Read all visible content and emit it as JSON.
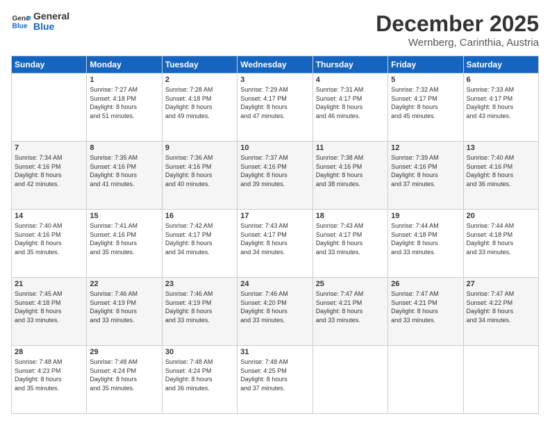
{
  "logo": {
    "line1": "General",
    "line2": "Blue"
  },
  "title": "December 2025",
  "subtitle": "Wernberg, Carinthia, Austria",
  "days_header": [
    "Sunday",
    "Monday",
    "Tuesday",
    "Wednesday",
    "Thursday",
    "Friday",
    "Saturday"
  ],
  "weeks": [
    [
      {
        "day": "",
        "text": ""
      },
      {
        "day": "1",
        "text": "Sunrise: 7:27 AM\nSunset: 4:18 PM\nDaylight: 8 hours\nand 51 minutes."
      },
      {
        "day": "2",
        "text": "Sunrise: 7:28 AM\nSunset: 4:18 PM\nDaylight: 8 hours\nand 49 minutes."
      },
      {
        "day": "3",
        "text": "Sunrise: 7:29 AM\nSunset: 4:17 PM\nDaylight: 8 hours\nand 47 minutes."
      },
      {
        "day": "4",
        "text": "Sunrise: 7:31 AM\nSunset: 4:17 PM\nDaylight: 8 hours\nand 46 minutes."
      },
      {
        "day": "5",
        "text": "Sunrise: 7:32 AM\nSunset: 4:17 PM\nDaylight: 8 hours\nand 45 minutes."
      },
      {
        "day": "6",
        "text": "Sunrise: 7:33 AM\nSunset: 4:17 PM\nDaylight: 8 hours\nand 43 minutes."
      }
    ],
    [
      {
        "day": "7",
        "text": "Sunrise: 7:34 AM\nSunset: 4:16 PM\nDaylight: 8 hours\nand 42 minutes."
      },
      {
        "day": "8",
        "text": "Sunrise: 7:35 AM\nSunset: 4:16 PM\nDaylight: 8 hours\nand 41 minutes."
      },
      {
        "day": "9",
        "text": "Sunrise: 7:36 AM\nSunset: 4:16 PM\nDaylight: 8 hours\nand 40 minutes."
      },
      {
        "day": "10",
        "text": "Sunrise: 7:37 AM\nSunset: 4:16 PM\nDaylight: 8 hours\nand 39 minutes."
      },
      {
        "day": "11",
        "text": "Sunrise: 7:38 AM\nSunset: 4:16 PM\nDaylight: 8 hours\nand 38 minutes."
      },
      {
        "day": "12",
        "text": "Sunrise: 7:39 AM\nSunset: 4:16 PM\nDaylight: 8 hours\nand 37 minutes."
      },
      {
        "day": "13",
        "text": "Sunrise: 7:40 AM\nSunset: 4:16 PM\nDaylight: 8 hours\nand 36 minutes."
      }
    ],
    [
      {
        "day": "14",
        "text": "Sunrise: 7:40 AM\nSunset: 4:16 PM\nDaylight: 8 hours\nand 35 minutes."
      },
      {
        "day": "15",
        "text": "Sunrise: 7:41 AM\nSunset: 4:16 PM\nDaylight: 8 hours\nand 35 minutes."
      },
      {
        "day": "16",
        "text": "Sunrise: 7:42 AM\nSunset: 4:17 PM\nDaylight: 8 hours\nand 34 minutes."
      },
      {
        "day": "17",
        "text": "Sunrise: 7:43 AM\nSunset: 4:17 PM\nDaylight: 8 hours\nand 34 minutes."
      },
      {
        "day": "18",
        "text": "Sunrise: 7:43 AM\nSunset: 4:17 PM\nDaylight: 8 hours\nand 33 minutes."
      },
      {
        "day": "19",
        "text": "Sunrise: 7:44 AM\nSunset: 4:18 PM\nDaylight: 8 hours\nand 33 minutes."
      },
      {
        "day": "20",
        "text": "Sunrise: 7:44 AM\nSunset: 4:18 PM\nDaylight: 8 hours\nand 33 minutes."
      }
    ],
    [
      {
        "day": "21",
        "text": "Sunrise: 7:45 AM\nSunset: 4:18 PM\nDaylight: 8 hours\nand 33 minutes."
      },
      {
        "day": "22",
        "text": "Sunrise: 7:46 AM\nSunset: 4:19 PM\nDaylight: 8 hours\nand 33 minutes."
      },
      {
        "day": "23",
        "text": "Sunrise: 7:46 AM\nSunset: 4:19 PM\nDaylight: 8 hours\nand 33 minutes."
      },
      {
        "day": "24",
        "text": "Sunrise: 7:46 AM\nSunset: 4:20 PM\nDaylight: 8 hours\nand 33 minutes."
      },
      {
        "day": "25",
        "text": "Sunrise: 7:47 AM\nSunset: 4:21 PM\nDaylight: 8 hours\nand 33 minutes."
      },
      {
        "day": "26",
        "text": "Sunrise: 7:47 AM\nSunset: 4:21 PM\nDaylight: 8 hours\nand 33 minutes."
      },
      {
        "day": "27",
        "text": "Sunrise: 7:47 AM\nSunset: 4:22 PM\nDaylight: 8 hours\nand 34 minutes."
      }
    ],
    [
      {
        "day": "28",
        "text": "Sunrise: 7:48 AM\nSunset: 4:23 PM\nDaylight: 8 hours\nand 35 minutes."
      },
      {
        "day": "29",
        "text": "Sunrise: 7:48 AM\nSunset: 4:24 PM\nDaylight: 8 hours\nand 35 minutes."
      },
      {
        "day": "30",
        "text": "Sunrise: 7:48 AM\nSunset: 4:24 PM\nDaylight: 8 hours\nand 36 minutes."
      },
      {
        "day": "31",
        "text": "Sunrise: 7:48 AM\nSunset: 4:25 PM\nDaylight: 8 hours\nand 37 minutes."
      },
      {
        "day": "",
        "text": ""
      },
      {
        "day": "",
        "text": ""
      },
      {
        "day": "",
        "text": ""
      }
    ]
  ]
}
